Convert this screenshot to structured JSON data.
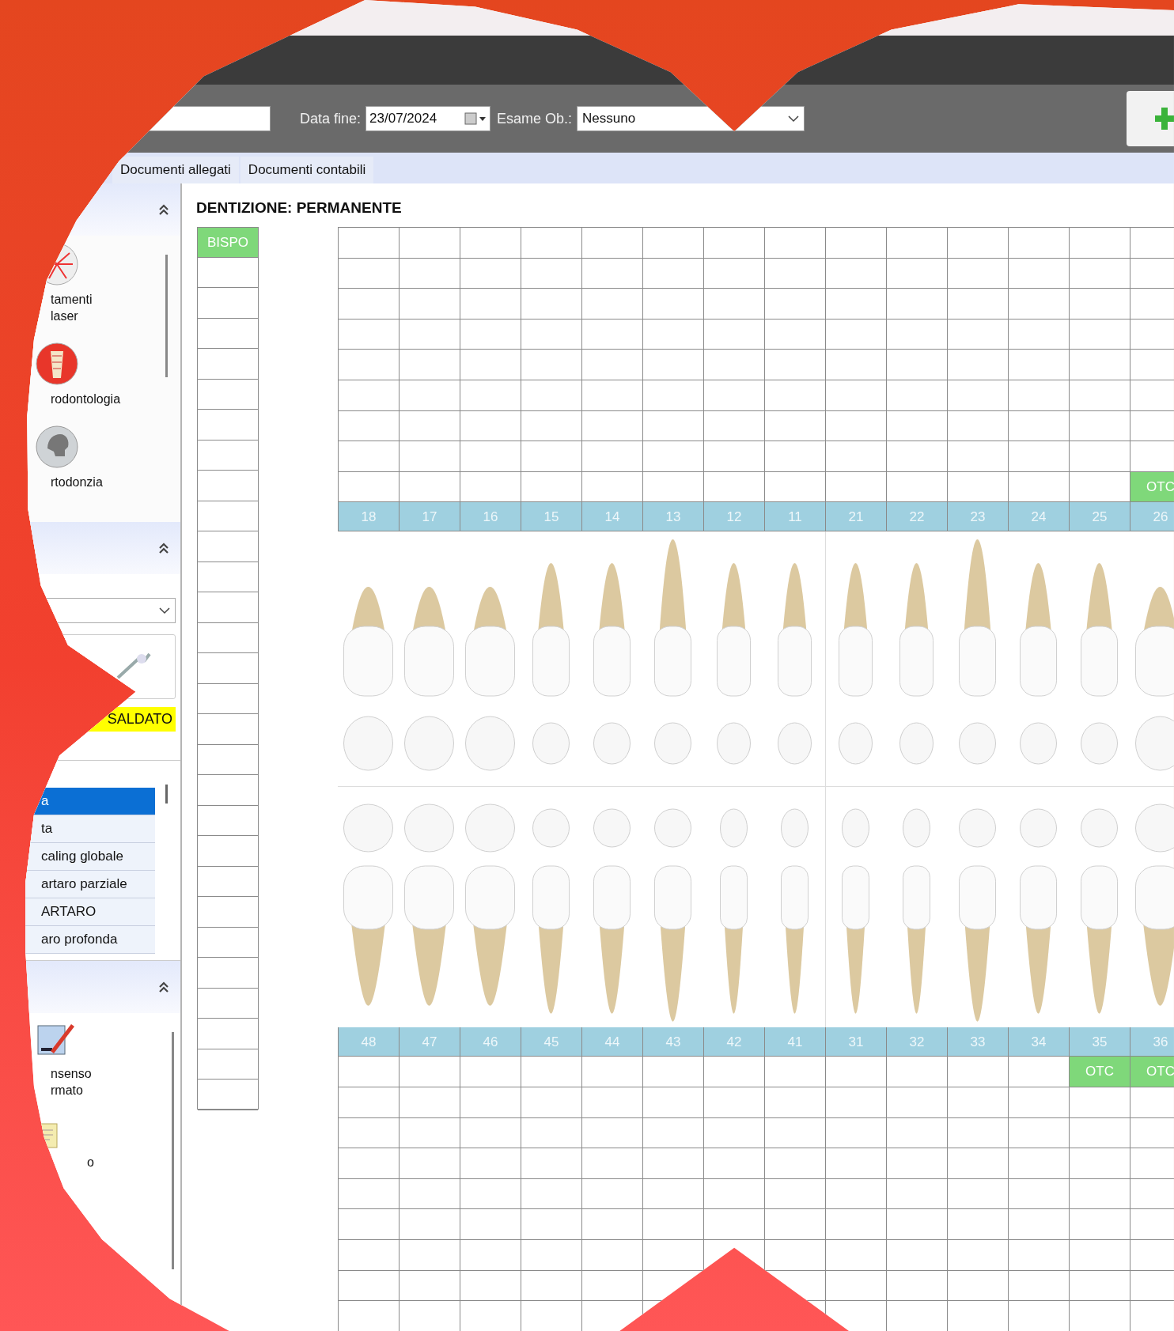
{
  "toolbar": {
    "end_date_label": "Data fine:",
    "end_date": "23/07/2024",
    "exam_label": "Esame Ob.:",
    "exam_value": "Nessuno"
  },
  "tabs": [
    {
      "label": "Documenti allegati",
      "selected": false
    },
    {
      "label": "Documenti contabili",
      "selected": false
    }
  ],
  "sidebar": {
    "panel_1": {
      "items": [
        {
          "kind": "laser",
          "lines": [
            "tamenti",
            "laser"
          ]
        },
        {
          "kind": "implant",
          "lines": [
            "rodontologia"
          ]
        },
        {
          "kind": "skull",
          "lines": [
            "rtodonzia"
          ]
        }
      ]
    },
    "panel_2": {
      "status": "SALDATO",
      "list": [
        {
          "label": "a",
          "selected": true
        },
        {
          "label": "ta",
          "selected": false
        },
        {
          "label": "caling globale",
          "selected": false
        },
        {
          "label": "artaro parziale",
          "selected": false
        },
        {
          "label": "ARTARO",
          "selected": false
        },
        {
          "label": "aro profonda",
          "selected": false
        }
      ]
    },
    "panel_3": {
      "items": [
        {
          "kind": "pen",
          "lines": [
            "nsenso",
            "rmato"
          ]
        },
        {
          "kind": "note",
          "lines": [
            "o"
          ]
        }
      ]
    }
  },
  "chart": {
    "title": "DENTIZIONE: PERMANENTE",
    "side_tag": "BISPO",
    "upper_teeth": [
      {
        "number": "18",
        "kind": "molar"
      },
      {
        "number": "17",
        "kind": "molar"
      },
      {
        "number": "16",
        "kind": "molar"
      },
      {
        "number": "15",
        "kind": "premolar"
      },
      {
        "number": "14",
        "kind": "premolar"
      },
      {
        "number": "13",
        "kind": "canine"
      },
      {
        "number": "12",
        "kind": "incisor"
      },
      {
        "number": "11",
        "kind": "incisor"
      },
      {
        "number": "21",
        "kind": "incisor"
      },
      {
        "number": "22",
        "kind": "incisor"
      },
      {
        "number": "23",
        "kind": "canine"
      },
      {
        "number": "24",
        "kind": "premolar"
      },
      {
        "number": "25",
        "kind": "premolar"
      },
      {
        "number": "26",
        "kind": "molar",
        "mark": "OTC"
      }
    ],
    "lower_teeth": [
      {
        "number": "48",
        "kind": "molar"
      },
      {
        "number": "47",
        "kind": "molar"
      },
      {
        "number": "46",
        "kind": "molar"
      },
      {
        "number": "45",
        "kind": "premolar"
      },
      {
        "number": "44",
        "kind": "premolar"
      },
      {
        "number": "43",
        "kind": "canine"
      },
      {
        "number": "42",
        "kind": "incisor"
      },
      {
        "number": "41",
        "kind": "incisor"
      },
      {
        "number": "31",
        "kind": "incisor"
      },
      {
        "number": "32",
        "kind": "incisor"
      },
      {
        "number": "33",
        "kind": "canine"
      },
      {
        "number": "34",
        "kind": "premolar"
      },
      {
        "number": "35",
        "kind": "premolar",
        "mark": "OTC"
      },
      {
        "number": "36",
        "kind": "molar",
        "mark": "OTC"
      }
    ]
  }
}
